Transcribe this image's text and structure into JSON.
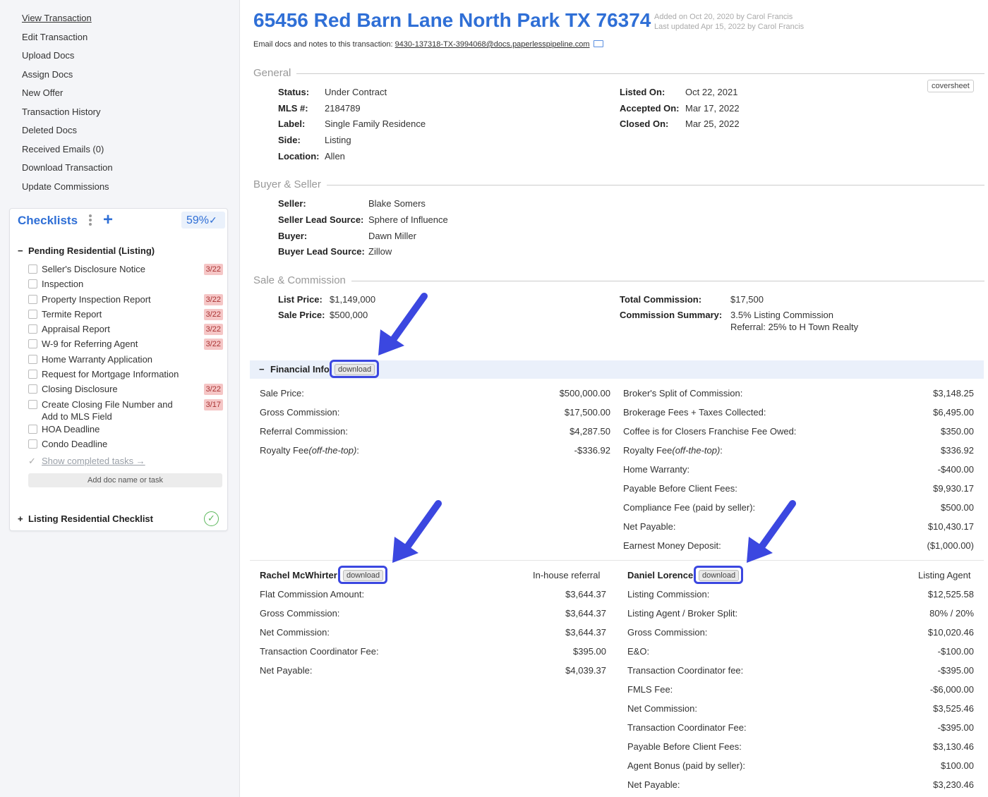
{
  "sidebar": {
    "nav": [
      "View Transaction",
      "Edit Transaction",
      "Upload Docs",
      "Assign Docs",
      "New Offer",
      "Transaction History",
      "Deleted Docs",
      "Received Emails (0)",
      "Download Transaction",
      "Update Commissions"
    ],
    "checklists": {
      "title": "Checklists",
      "add_symbol": "+",
      "progress": "59%",
      "progress_check": "✓",
      "pending_symbol": "−",
      "pending_group": "Pending Residential (Listing)",
      "items": [
        {
          "label": "Seller's Disclosure Notice",
          "due": "3/22"
        },
        {
          "label": "Inspection",
          "due": ""
        },
        {
          "label": "Property Inspection Report",
          "due": "3/22"
        },
        {
          "label": "Termite Report",
          "due": "3/22"
        },
        {
          "label": "Appraisal Report",
          "due": "3/22"
        },
        {
          "label": "W-9 for Referring Agent",
          "due": "3/22"
        },
        {
          "label": "Home Warranty Application",
          "due": ""
        },
        {
          "label": "Request for Mortgage Information",
          "due": ""
        },
        {
          "label": "Closing Disclosure",
          "due": "3/22"
        },
        {
          "label": "Create Closing File Number and Add to MLS Field",
          "due": "3/17"
        },
        {
          "label": "HOA Deadline",
          "due": ""
        },
        {
          "label": "Condo Deadline",
          "due": ""
        }
      ],
      "show_completed_tick": "✓",
      "show_completed": "Show completed tasks →",
      "add_doc": "Add doc name or task",
      "listing_symbol": "+",
      "listing_group": "Listing Residential Checklist",
      "listing_done": "✓"
    }
  },
  "header": {
    "title": "65456 Red Barn Lane North Park TX 76374",
    "added": "Added on Oct 20, 2020 by Carol Francis",
    "updated": "Last updated Apr 15, 2022 by Carol Francis",
    "email_prefix": "Email docs and notes to this transaction:",
    "email": "9430-137318-TX-3994068@docs.paperlesspipeline.com"
  },
  "general": {
    "heading": "General",
    "coversheet": "coversheet",
    "left": [
      {
        "k": "Status:",
        "v": "Under Contract"
      },
      {
        "k": "MLS #:",
        "v": "2184789"
      },
      {
        "k": "Label:",
        "v": "Single Family Residence"
      },
      {
        "k": "Side:",
        "v": "Listing"
      },
      {
        "k": "Location:",
        "v": "Allen"
      }
    ],
    "right": [
      {
        "k": "Listed On:",
        "v": "Oct 22, 2021"
      },
      {
        "k": "Accepted On:",
        "v": "Mar 17, 2022"
      },
      {
        "k": "Closed On:",
        "v": "Mar 25, 2022"
      }
    ]
  },
  "buyer_seller": {
    "heading": "Buyer & Seller",
    "rows": [
      {
        "k": "Seller:",
        "v": "Blake Somers"
      },
      {
        "k": "Seller Lead Source:",
        "v": "Sphere of Influence"
      },
      {
        "k": "Buyer:",
        "v": "Dawn Miller"
      },
      {
        "k": "Buyer Lead Source:",
        "v": "Zillow"
      }
    ]
  },
  "sale": {
    "heading": "Sale & Commission",
    "left": [
      {
        "k": "List Price:",
        "v": "$1,149,000"
      },
      {
        "k": "Sale Price:",
        "v": "$500,000"
      }
    ],
    "total_commission_k": "Total Commission:",
    "total_commission_v": "$17,500",
    "summary_k": "Commission Summary:",
    "summary_v1": "3.5% Listing Commission",
    "summary_v2": "Referral: 25% to H Town Realty"
  },
  "financial": {
    "collapse_symbol": "−",
    "label": "Financial Info",
    "download": "download",
    "left": [
      {
        "l": "Sale Price:",
        "r": "$500,000.00"
      },
      {
        "l": "Gross Commission:",
        "r": "$17,500.00"
      },
      {
        "l": "Referral Commission:",
        "r": "$4,287.50"
      },
      {
        "l": "Royalty Fee",
        "em": "(off-the-top)",
        "colon": ":",
        "r": "-$336.92"
      }
    ],
    "right": [
      {
        "l": "Broker's Split of Commission:",
        "r": "$3,148.25"
      },
      {
        "l": "Brokerage Fees + Taxes Collected:",
        "r": "$6,495.00"
      },
      {
        "l": "Coffee is for Closers Franchise Fee Owed:",
        "r": "$350.00"
      },
      {
        "l": "Royalty Fee",
        "em": "(off-the-top)",
        "colon": ":",
        "r": "$336.92"
      },
      {
        "l": "Home Warranty:",
        "r": "-$400.00"
      },
      {
        "l": "Payable Before Client Fees:",
        "r": "$9,930.17"
      },
      {
        "l": "Compliance Fee (paid by seller):",
        "r": "$500.00"
      },
      {
        "l": "Net Payable:",
        "r": "$10,430.17"
      },
      {
        "l": "Earnest Money Deposit:",
        "r": "($1,000.00)"
      }
    ]
  },
  "agents": [
    {
      "name": "Rachel McWhirter",
      "download": "download",
      "role": "In-house referral",
      "rows": [
        {
          "l": "Flat Commission Amount:",
          "r": "$3,644.37"
        },
        {
          "l": "Gross Commission:",
          "r": "$3,644.37"
        },
        {
          "l": "Net Commission:",
          "r": "$3,644.37"
        },
        {
          "l": "Transaction Coordinator Fee:",
          "r": "$395.00"
        },
        {
          "l": "Net Payable:",
          "r": "$4,039.37"
        }
      ]
    },
    {
      "name": "Daniel Lorence",
      "download": "download",
      "role": "Listing Agent",
      "rows": [
        {
          "l": "Listing Commission:",
          "r": "$12,525.58"
        },
        {
          "l": "Listing Agent / Broker Split:",
          "r": "80% / 20%"
        },
        {
          "l": "Gross Commission:",
          "r": "$10,020.46"
        },
        {
          "l": "E&O:",
          "r": "-$100.00"
        },
        {
          "l": "Transaction Coordinator fee:",
          "r": "-$395.00"
        },
        {
          "l": "FMLS Fee:",
          "r": "-$6,000.00"
        },
        {
          "l": "Net Commission:",
          "r": "$3,525.46"
        },
        {
          "l": "Transaction Coordinator Fee:",
          "r": "-$395.00"
        },
        {
          "l": "Payable Before Client Fees:",
          "r": "$3,130.46"
        },
        {
          "l": "Agent Bonus (paid by seller):",
          "r": "$100.00"
        },
        {
          "l": "Net Payable:",
          "r": "$3,230.46"
        }
      ]
    }
  ],
  "colors": {
    "accent": "#2f6fd6",
    "highlight": "#3b47e0",
    "due_bg": "#f5c6c6",
    "done": "#5cb85c"
  }
}
